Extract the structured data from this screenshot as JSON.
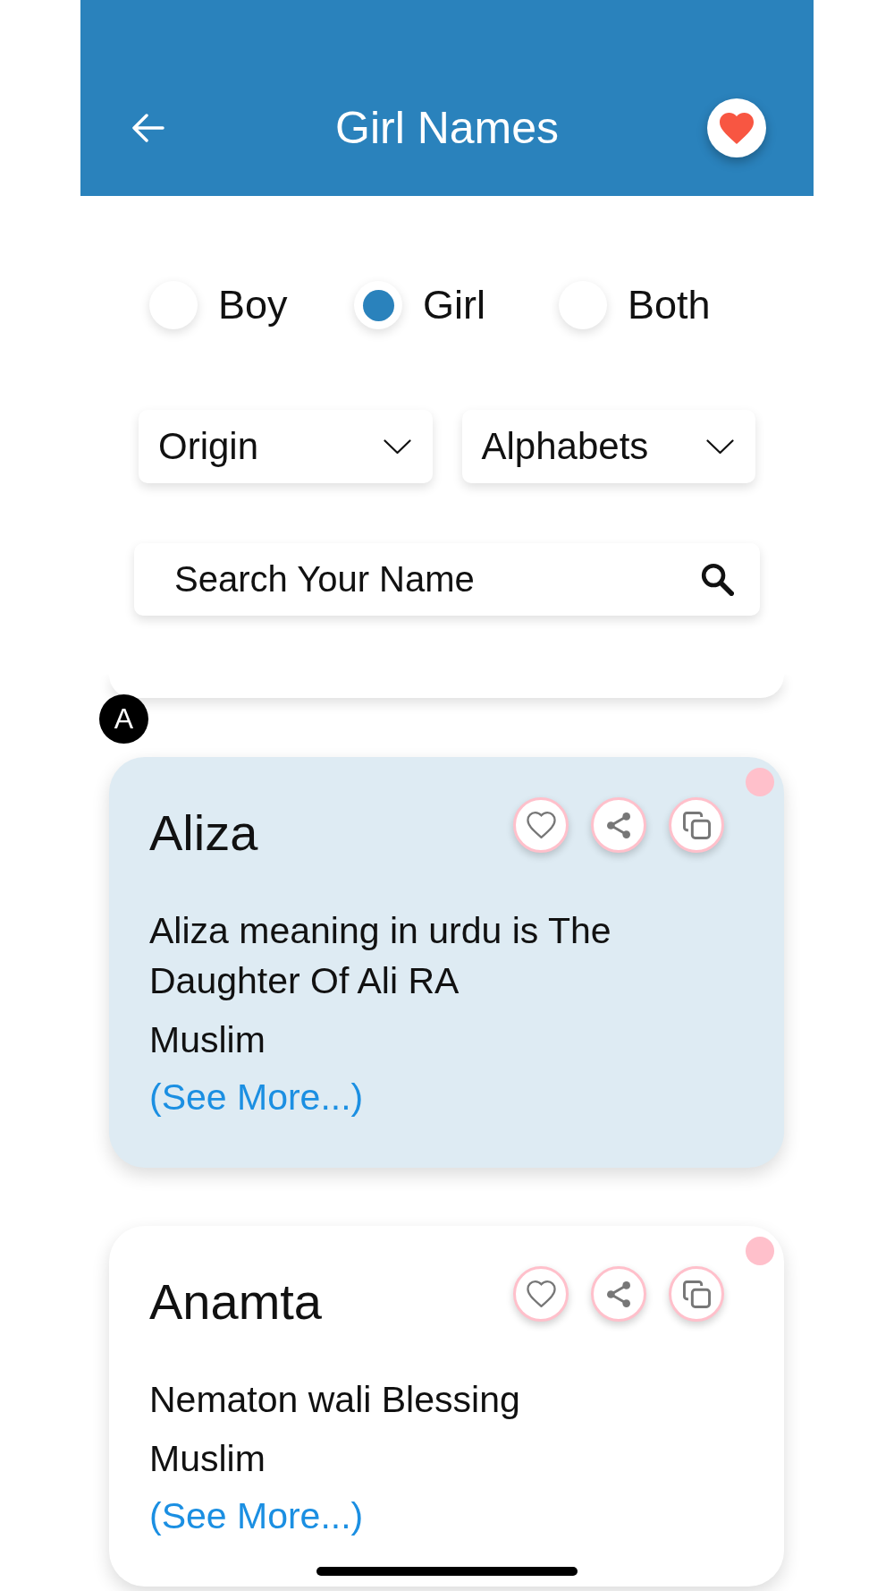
{
  "header": {
    "title": "Girl Names"
  },
  "gender_options": [
    {
      "label": "Boy",
      "selected": false
    },
    {
      "label": "Girl",
      "selected": true
    },
    {
      "label": "Both",
      "selected": false
    }
  ],
  "filters": [
    {
      "label": "Origin"
    },
    {
      "label": "Alphabets"
    }
  ],
  "search": {
    "placeholder": "Search Your Name"
  },
  "section_letter": "A",
  "names": [
    {
      "name": "Aliza",
      "meaning": "Aliza meaning in urdu is The Daughter Of Ali RA",
      "origin": "Muslim",
      "link": "(See More...)",
      "highlighted": true,
      "color": "#ffc0cb"
    },
    {
      "name": "Anamta",
      "meaning": "Nematon wali Blessing",
      "origin": "Muslim",
      "link": "(See More...)",
      "highlighted": false,
      "color": "#ffc0cb"
    }
  ]
}
